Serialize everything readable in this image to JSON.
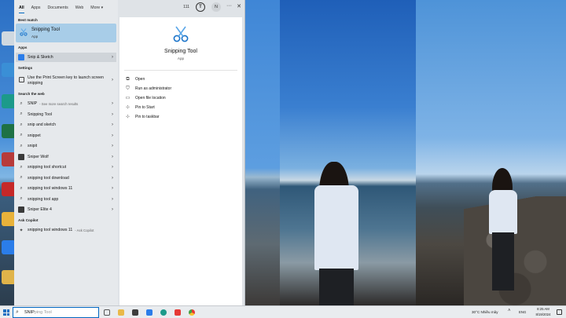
{
  "tabs": [
    "All",
    "Apps",
    "Documents",
    "Web",
    "More"
  ],
  "more_chevron": "▾",
  "header": {
    "count": "111",
    "avatar_initial": "N",
    "more_dots": "···",
    "close": "✕"
  },
  "best_match": {
    "label": "Best match",
    "title": "Snipping Tool",
    "subtitle": "App"
  },
  "apps": {
    "label": "Apps",
    "item": "Snip & Sketch"
  },
  "settings": {
    "label": "Settings",
    "item": "Use the Print Screen key to launch screen snipping"
  },
  "web": {
    "label": "Search the web",
    "items": [
      {
        "text": "SNIP",
        "hint": "- See more search results",
        "icon": "search-icon"
      },
      {
        "text": "Snipping Tool",
        "icon": "search-icon"
      },
      {
        "text": "snip and sketch",
        "icon": "search-icon"
      },
      {
        "text": "snippet",
        "icon": "search-icon"
      },
      {
        "text": "snipit",
        "icon": "search-icon"
      },
      {
        "text": "Sniper Wolf",
        "icon": "image-icon"
      },
      {
        "text": "snipping tool shortcut",
        "icon": "search-icon"
      },
      {
        "text": "snipping tool download",
        "icon": "search-icon"
      },
      {
        "text": "snipping tool windows 11",
        "icon": "search-icon"
      },
      {
        "text": "snipping tool app",
        "icon": "search-icon"
      },
      {
        "text": "Sniper Elite 4",
        "icon": "image-icon"
      }
    ]
  },
  "copilot": {
    "label": "Ask Copilot",
    "text": "snipping tool windows 11",
    "hint": "- Ask Copilot"
  },
  "detail": {
    "title": "Snipping Tool",
    "subtitle": "App",
    "actions": [
      "Open",
      "Run as administrator",
      "Open file location",
      "Pin to Start",
      "Pin to taskbar"
    ]
  },
  "taskbar": {
    "search_typed": "SNIP",
    "search_ghost": "ping Tool",
    "weather": "30°C  Nhiều mây",
    "language": "ENG",
    "time": "8:25 AM",
    "date": "8/19/2024"
  },
  "colors": {
    "accent": "#0067c0",
    "selected": "#a8cde8",
    "panel": "#e6e9ec"
  }
}
